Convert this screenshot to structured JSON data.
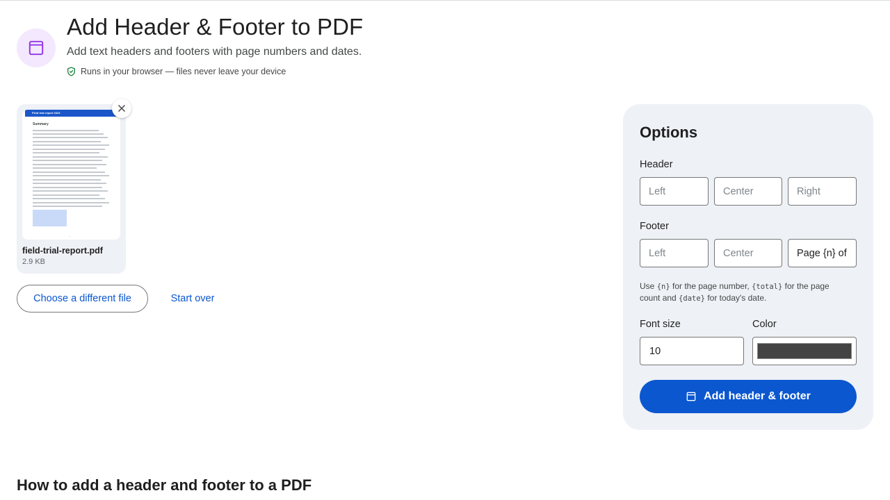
{
  "page": {
    "title": "Add Header & Footer to PDF",
    "subtitle": "Add text headers and footers with page numbers and dates.",
    "privacy_note": "Runs in your browser — files never leave your device"
  },
  "file": {
    "name": "field-trial-report.pdf",
    "size": "2.9 KB",
    "thumbnail": {
      "banner": "Field trial report 2024",
      "heading": "Summary"
    }
  },
  "actions": {
    "choose_file": "Choose a different file",
    "start_over": "Start over"
  },
  "options": {
    "title": "Options",
    "header": {
      "label": "Header",
      "left_placeholder": "Left",
      "center_placeholder": "Center",
      "right_placeholder": "Right",
      "left_value": "",
      "center_value": "",
      "right_value": ""
    },
    "footer": {
      "label": "Footer",
      "left_placeholder": "Left",
      "center_placeholder": "Center",
      "right_placeholder": "Right",
      "left_value": "",
      "center_value": "",
      "right_value": "Page {n} of {total}"
    },
    "hint": {
      "part1": "Use ",
      "token_n": "{n}",
      "part2": " for the page number, ",
      "token_total": "{total}",
      "part3": " for the page count and ",
      "token_date": "{date}",
      "part4": " for today's date."
    },
    "font_size": {
      "label": "Font size",
      "value": "10"
    },
    "color": {
      "label": "Color",
      "value": "#444444"
    },
    "submit_label": "Add header & footer"
  },
  "howto": {
    "heading": "How to add a header and footer to a PDF"
  },
  "colors": {
    "accent": "#0b57d0",
    "panel_bg": "#eef1f6",
    "icon_purple": "#9334e6",
    "icon_bg": "#f3e8fd",
    "privacy_green": "#188038"
  },
  "icons": {
    "tool": "header-footer-icon",
    "privacy": "shield-check-icon",
    "remove": "close-icon",
    "submit": "header-footer-icon"
  }
}
